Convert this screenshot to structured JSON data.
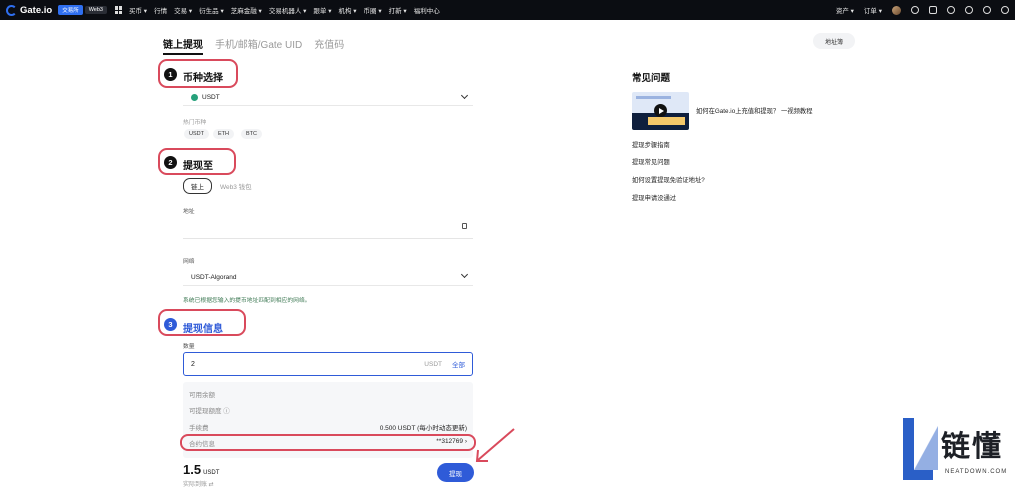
{
  "nav": {
    "logo": "Gate.io",
    "pill_exchange": "交易所",
    "pill_web3": "Web3",
    "items": [
      "买币 ▾",
      "行情",
      "交易 ▾",
      "衍生品 ▾",
      "芝麻金融 ▾",
      "交易机器人 ▾",
      "跟单 ▾",
      "机构 ▾",
      "币圈 ▾",
      "打新 ▾",
      "福利中心"
    ],
    "right": [
      "资产 ▾",
      "订单 ▾"
    ]
  },
  "tabs": [
    "链上提现",
    "手机/邮箱/Gate UID",
    "充值码"
  ],
  "address_book": "地址簿",
  "step1": {
    "num": "1",
    "title": "币种选择",
    "selected": "USDT",
    "hot_label": "热门币种",
    "chips": [
      "USDT",
      "ETH",
      "BTC"
    ]
  },
  "step2": {
    "num": "2",
    "title": "提现至",
    "seg_on": "链上",
    "seg_off": "Web3 钱包",
    "address_label": "地址",
    "network_label": "网络",
    "network_value": "USDT-Algorand",
    "hint": "系统已根据您输入的提币地址匹配到相应的网络。"
  },
  "step3": {
    "num": "3",
    "title": "提现信息",
    "amount_label": "数量",
    "amount_value": "2",
    "amount_unit": "USDT",
    "amount_all": "全部",
    "rows": [
      {
        "k": "可用余额",
        "v": ""
      },
      {
        "k": "可提现额度 ⓘ",
        "v": ""
      },
      {
        "k": "手续费",
        "v": "0.500 USDT (每小时动态更新)"
      },
      {
        "k": "合约信息",
        "v": "**312769 ›"
      }
    ],
    "total": "1.5",
    "total_unit": "USDT",
    "received": "实际到账 ⇄",
    "submit": "提现"
  },
  "faq": {
    "title": "常见问题",
    "video_text": "如何在Gate.io上充值和提现？ 一视频教程",
    "links": [
      "提现步骤指南",
      "提现常见问题",
      "如何设置提现免验证地址?",
      "提现申请没通过"
    ]
  },
  "watermark": {
    "cn": "链懂",
    "en": "NEATDOWN.COM"
  }
}
